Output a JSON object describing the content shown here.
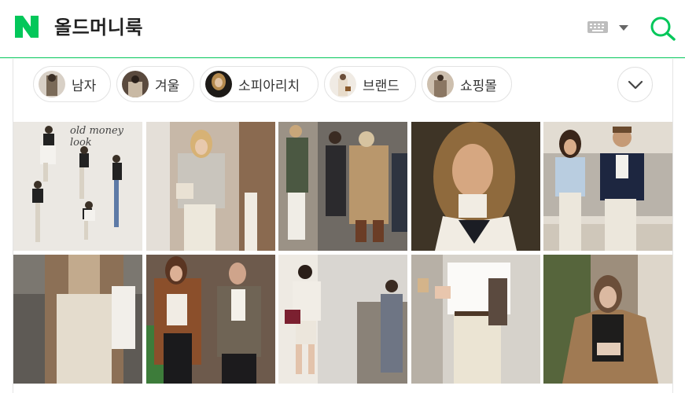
{
  "header": {
    "query": "올드머니룩",
    "logo_icon": "naver-logo-icon",
    "keyboard_icon": "keyboard-icon",
    "dropdown_icon": "caret-down-icon",
    "search_icon": "search-icon",
    "accent_color": "#03c75a"
  },
  "chips": [
    {
      "label": "남자"
    },
    {
      "label": "겨울"
    },
    {
      "label": "소피아리치"
    },
    {
      "label": "브랜드"
    },
    {
      "label": "쇼핑몰"
    }
  ],
  "more_icon": "chevron-down-icon",
  "images": [
    {
      "caption": "old money look"
    },
    {
      "caption": ""
    },
    {
      "caption": ""
    },
    {
      "caption": ""
    },
    {
      "caption": ""
    },
    {
      "caption": ""
    },
    {
      "caption": ""
    },
    {
      "caption": ""
    },
    {
      "caption": ""
    },
    {
      "caption": ""
    }
  ]
}
